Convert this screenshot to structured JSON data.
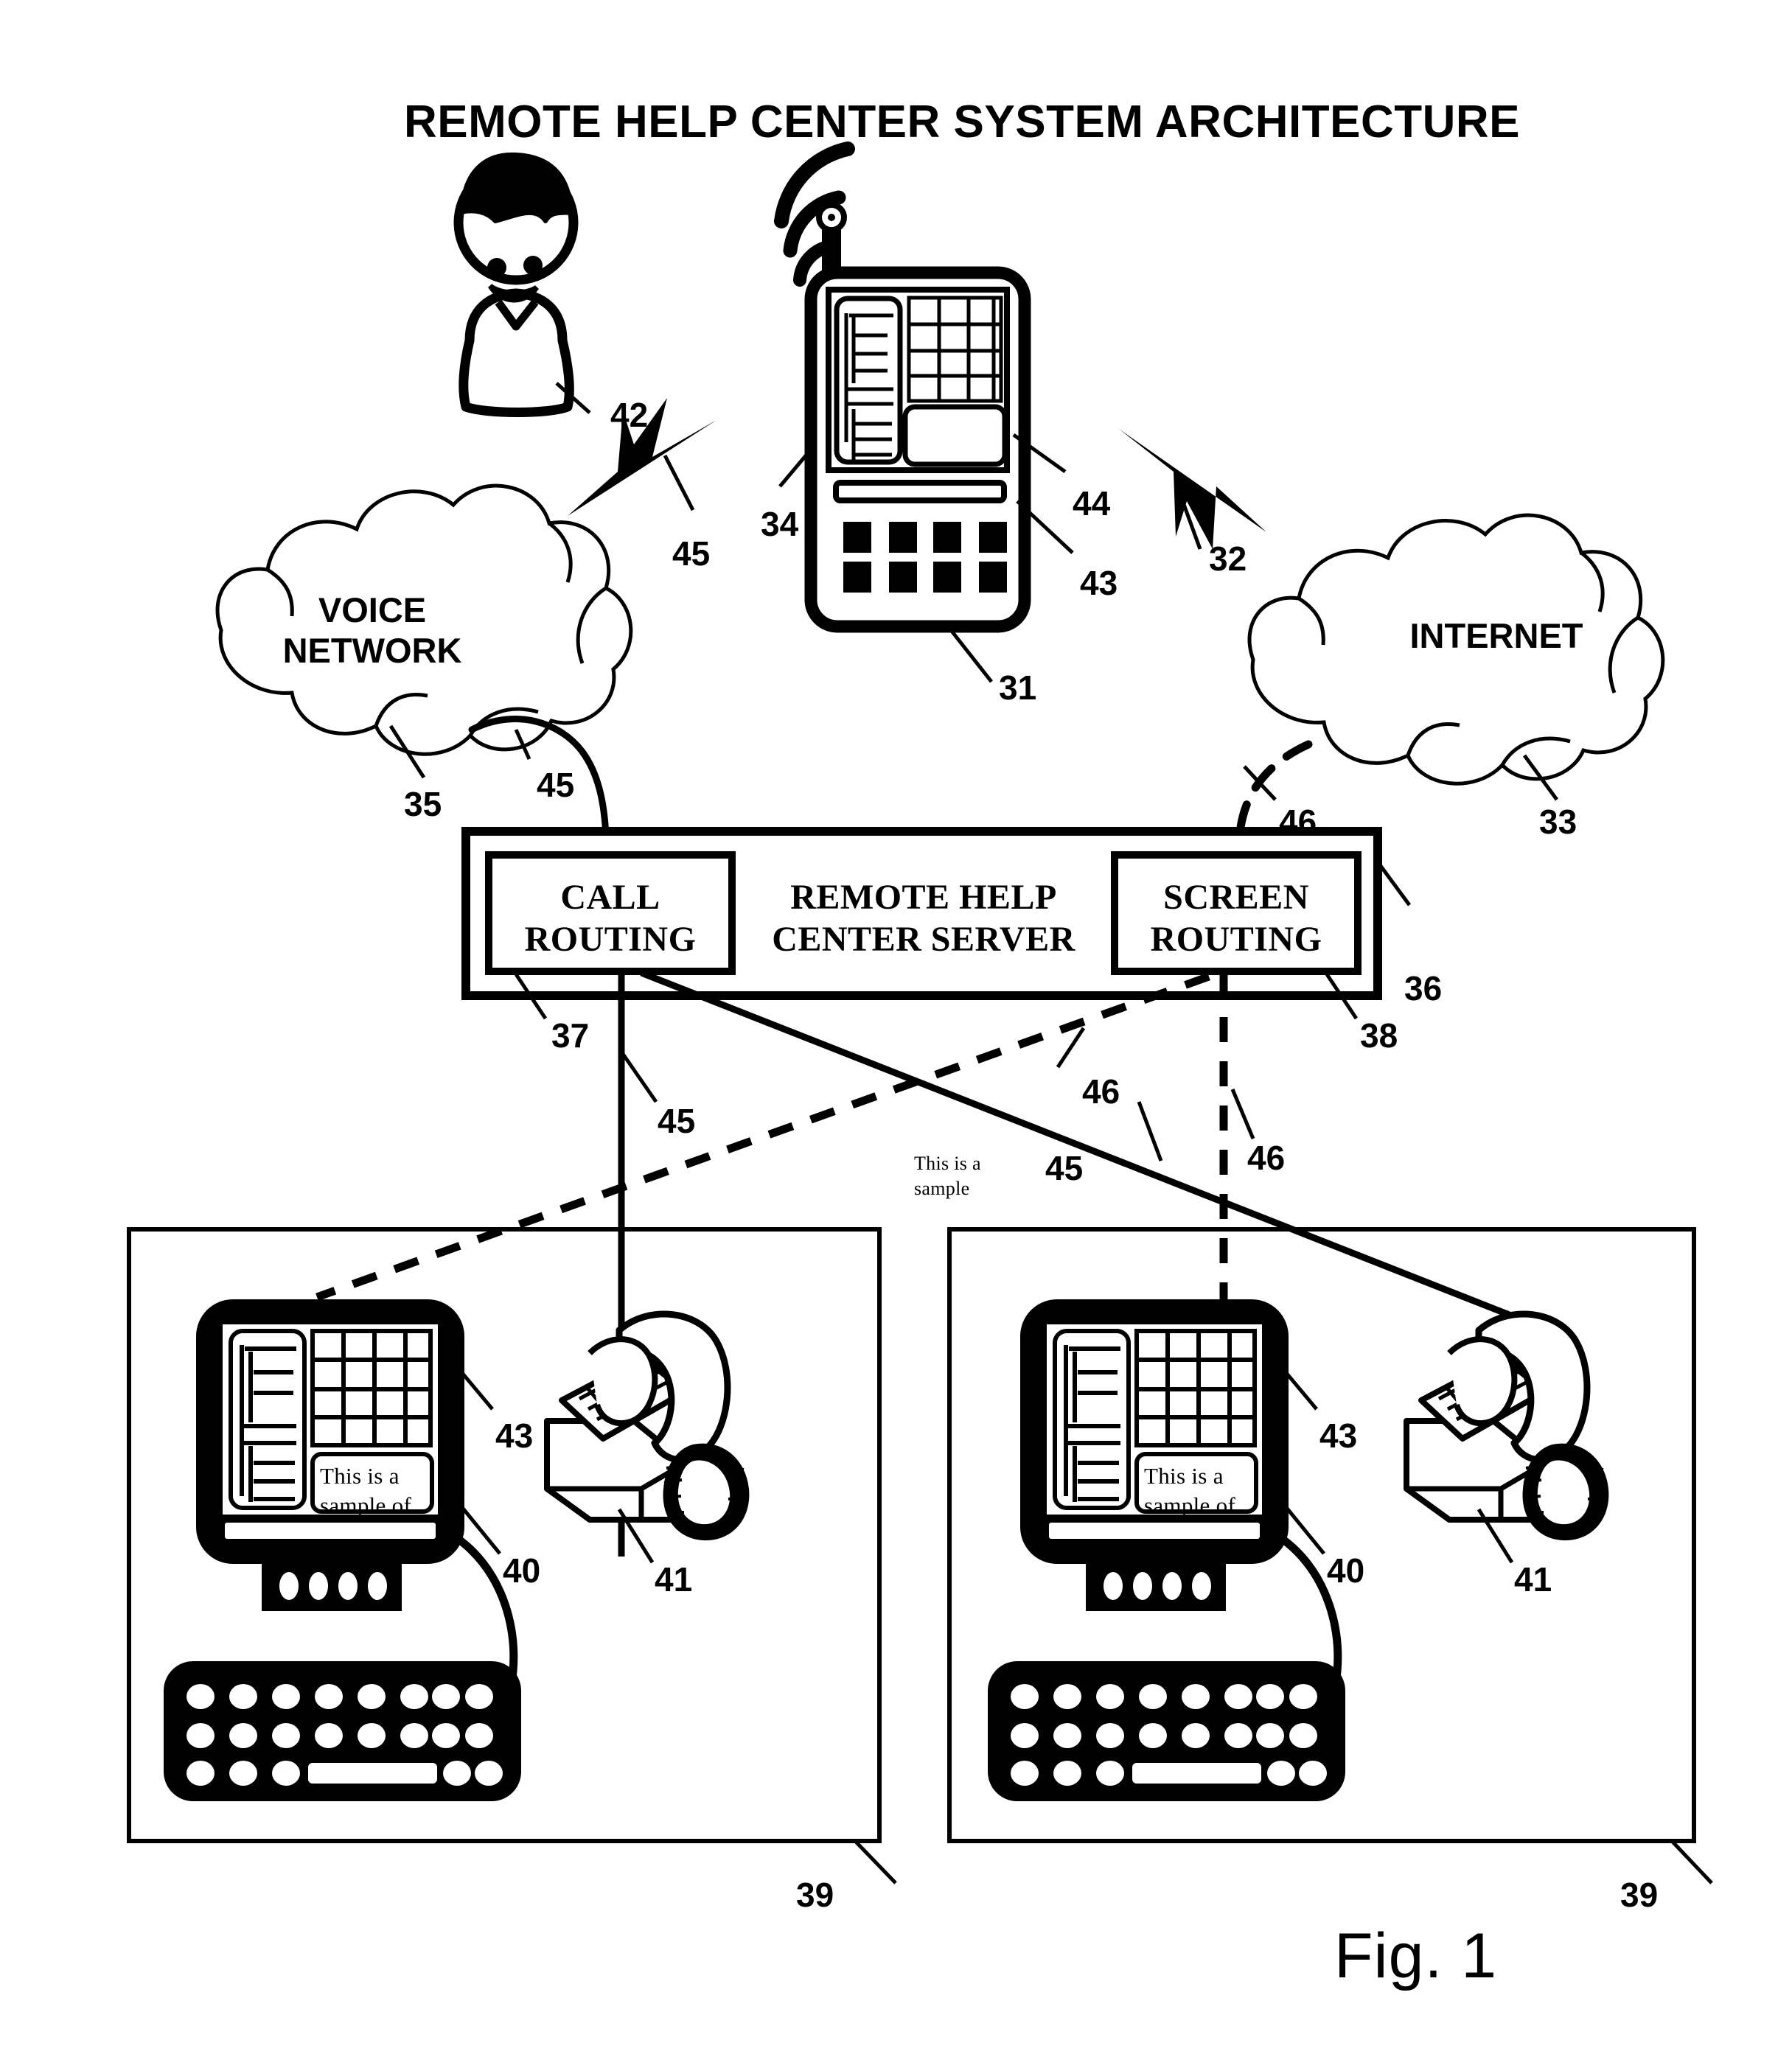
{
  "figure": {
    "title": "REMOTE HELP CENTER SYSTEM ARCHITECTURE",
    "figure_number": "Fig. 1"
  },
  "networks": {
    "voice": {
      "label": "VOICE\nNETWORK",
      "ref": "35"
    },
    "internet": {
      "label": "INTERNET",
      "ref": "33"
    }
  },
  "server": {
    "title": "REMOTE HELP\nCENTER SERVER",
    "ref": "36",
    "call_routing": {
      "label": "CALL\nROUTING",
      "ref": "37"
    },
    "screen_routing": {
      "label": "SCREEN\nROUTING",
      "ref": "38"
    }
  },
  "mobile_device": {
    "ref_device": "31",
    "ref_display": "34",
    "ref_keypad": "43",
    "ref_textbox": "44",
    "screen_text": "This is a\nsample"
  },
  "user": {
    "ref": "42"
  },
  "links": {
    "voice_ref": "45",
    "screen_ref": "46",
    "wireless_voice_ref": "45",
    "wireless_data_ref": "32"
  },
  "workstations": [
    {
      "ref_box": "39",
      "ref_monitor": "43",
      "ref_computer": "40",
      "ref_phone": "41",
      "screen_text": "This is a\nsample of"
    },
    {
      "ref_box": "39",
      "ref_monitor": "43",
      "ref_computer": "40",
      "ref_phone": "41",
      "screen_text": "This is a\nsample of"
    }
  ]
}
